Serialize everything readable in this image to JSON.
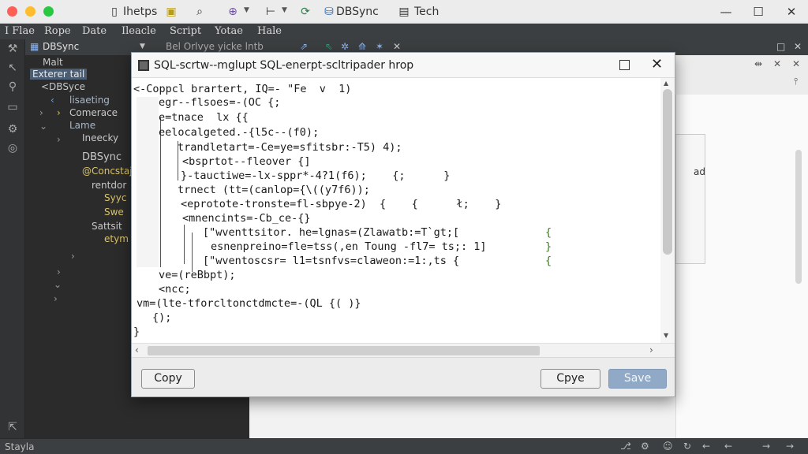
{
  "titlebar": {
    "items": [
      "Ihetps",
      "DBSync",
      "Tech"
    ],
    "controls": [
      "—",
      "☐",
      "✕"
    ]
  },
  "menubar": {
    "items": [
      "I Flae",
      "Rope",
      "Date",
      "Ileacle",
      "Script",
      "Yotae",
      "Hale"
    ]
  },
  "project": {
    "title": "DBSync",
    "tree": [
      "Malt",
      "Exterer tail",
      "<DBSyce",
      "lisaeting",
      "Comerace",
      "Lame",
      "Ineecky",
      "DBSync",
      "@Concstajt",
      "rentdor",
      "Syyc",
      "Swe",
      "Sattsit",
      "etym"
    ]
  },
  "editor": {
    "tab_text": "Bel Orlvye yicke lntb",
    "right_label": "ad"
  },
  "statusbar": {
    "left": "Stayla"
  },
  "dialog": {
    "title": "SQL-scrtw--mglupt SQL-enerpt-scltripader hrop",
    "code_lines": [
      "<-Coppcl brartert, IQ=- \"Fe  v  1)",
      "egr--flsoes=-(OC {;",
      "e=tnace  lx {{",
      "eelocalgeted.-{l5c--(f0);",
      "trandletart=-Ce=ye=sfitsbr:-T5) 4);",
      "<bsprtot--fleover {]",
      "}-tauctiwe=-lx-sppr*-4?1(f6);    {;      }",
      "trnect (tt=(canlop={\\((y7f6));",
      "<eprotote-tronste=fl-sbpye-2)  {    {      ł;    }",
      "<mnencints=-Cb_ce-{}",
      "[\"wventtsitor. he=lgnas=(Zlawatb:=T`gt;[",
      "esnenpreino=fle=tss(,en Toung -fl7= ts;: 1]",
      "[\"wventoscsr= l1=tsnfvs=claweon:=1:,ts {",
      "ve=(reBbpt);",
      "<ncc;",
      "vm=(lte-tforcltonctdmcte=-(QL {( )}",
      "{);",
      "}"
    ],
    "gutter_marks": [
      "{",
      "}",
      "{"
    ],
    "buttons": {
      "copy_left": "Copy",
      "copy_right": "Cpye",
      "save": "Save"
    }
  }
}
